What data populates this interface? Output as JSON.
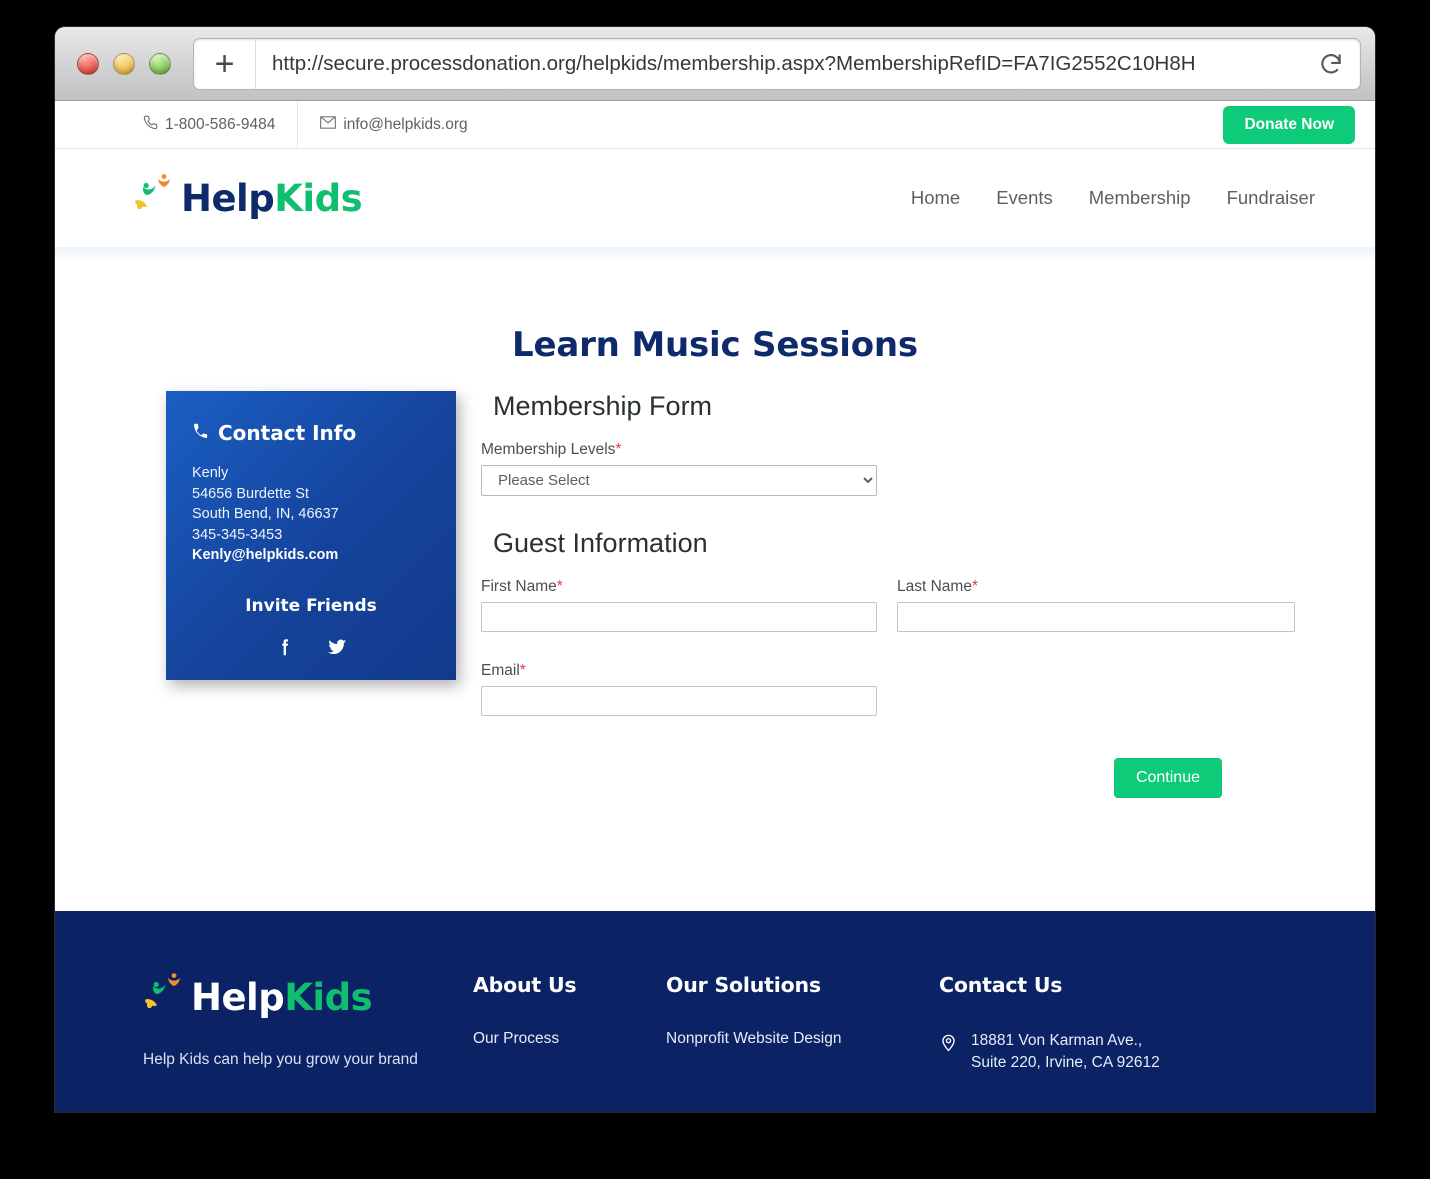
{
  "browser": {
    "url": "http://secure.processdonation.org/helpkids/membership.aspx?MembershipRefID=FA7IG2552C10H8H",
    "new_tab_label": "+",
    "reload_label": "reload-icon",
    "traffic_lights": [
      "close",
      "minimize",
      "zoom"
    ]
  },
  "topbar": {
    "phone": "1-800-586-9484",
    "email": "info@helpkids.org",
    "donate_label": "Donate Now"
  },
  "brand": {
    "name_first": "Help",
    "name_second": "Kids"
  },
  "nav": {
    "items": [
      {
        "label": "Home"
      },
      {
        "label": "Events"
      },
      {
        "label": "Membership"
      },
      {
        "label": "Fundraiser"
      }
    ]
  },
  "page": {
    "title": "Learn Music Sessions"
  },
  "contact_card": {
    "title": "Contact Info",
    "name": "Kenly",
    "street": "54656 Burdette St",
    "city_state_zip": "South Bend, IN, 46637",
    "phone": "345-345-3453",
    "email": "Kenly@helpkids.com",
    "invite_title": "Invite Friends",
    "social": [
      {
        "name": "facebook-icon"
      },
      {
        "name": "twitter-icon"
      }
    ]
  },
  "form": {
    "membership_section_title": "Membership Form",
    "membership_levels_label": "Membership Levels",
    "membership_levels_required": "*",
    "membership_levels_value": "Please Select",
    "membership_levels_options": [
      "Please Select"
    ],
    "guest_section_title": "Guest Information",
    "first_name_label": "First Name",
    "first_name_required": "*",
    "first_name_value": "",
    "last_name_label": "Last Name",
    "last_name_required": "*",
    "last_name_value": "",
    "email_label": "Email",
    "email_required": "*",
    "email_value": "",
    "continue_label": "Continue"
  },
  "footer": {
    "tagline": "Help Kids can help you grow your brand",
    "about": {
      "heading": "About Us",
      "links": [
        {
          "label": "Our Process"
        }
      ]
    },
    "solutions": {
      "heading": "Our Solutions",
      "links": [
        {
          "label": "Nonprofit Website Design"
        }
      ]
    },
    "contact": {
      "heading": "Contact Us",
      "address_line1": "18881 Von Karman Ave.,",
      "address_line2": "Suite 220, Irvine, CA 92612"
    }
  },
  "colors": {
    "accent_green": "#0ECB79",
    "brand_navy": "#0F2A6B",
    "brand_green": "#0FBE6E",
    "footer_navy": "#0B2265",
    "card_blue": "#15439B",
    "required_red": "#E23B3B"
  }
}
